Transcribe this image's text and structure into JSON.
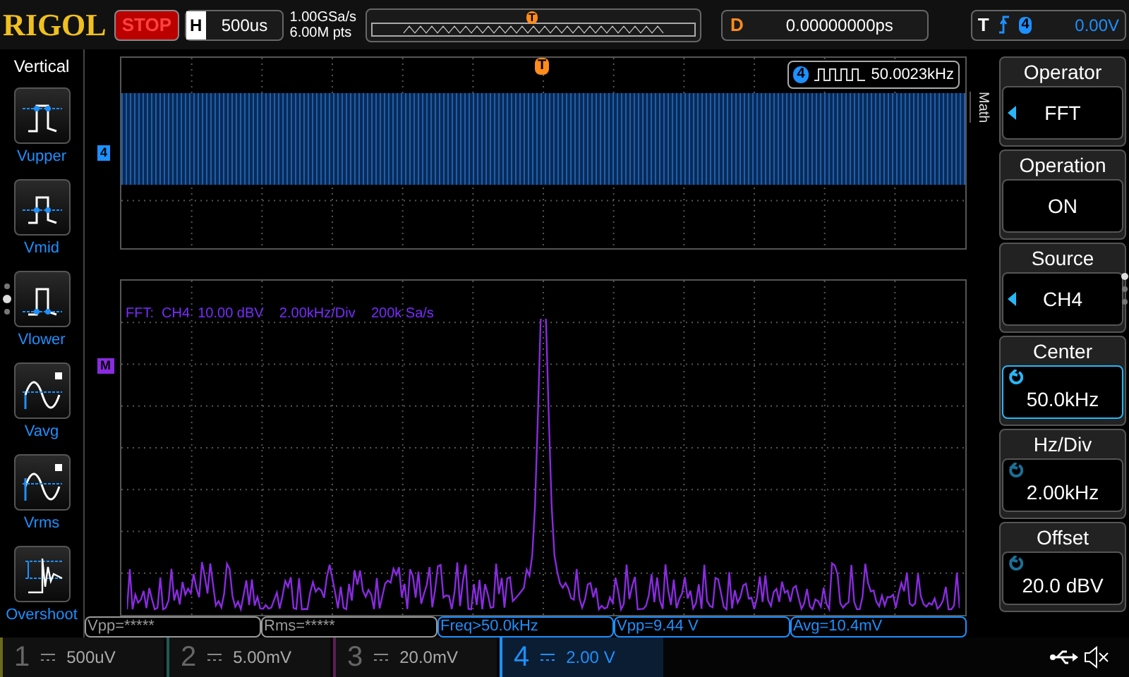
{
  "header": {
    "brand": "RIGOL",
    "run_state": "STOP",
    "timebase": {
      "label": "H",
      "value": "500us"
    },
    "sample_rate": "1.00GSa/s",
    "memory_depth": "6.00M pts",
    "memory_trigger_marker": "T",
    "delay": {
      "label": "D",
      "value": "0.00000000ps"
    },
    "trigger": {
      "label": "T",
      "channel": "4",
      "level": "0.00V"
    }
  },
  "left_menu": {
    "title": "Vertical",
    "items": [
      {
        "label": "Vupper",
        "kind": "upper"
      },
      {
        "label": "Vmid",
        "kind": "mid"
      },
      {
        "label": "Vlower",
        "kind": "lower"
      },
      {
        "label": "Vavg",
        "kind": "avg"
      },
      {
        "label": "Vrms",
        "kind": "rms"
      },
      {
        "label": "Overshoot",
        "kind": "overshoot"
      }
    ]
  },
  "upper_window": {
    "channel_marker": "4",
    "trigger_marker": "T",
    "frequency": {
      "channel": "4",
      "value": "50.0023kHz"
    },
    "side_tab": "Math"
  },
  "fft_window": {
    "marker": "M",
    "info": "FFT:  CH4  10.00 dBV    2.00kHz/Div    200k Sa/s"
  },
  "measurements": [
    {
      "text": "Vpp=*****",
      "color": "#9a9a9a"
    },
    {
      "text": "Rms=*****",
      "color": "#9a9a9a"
    },
    {
      "text": "Freq>50.0kHz",
      "color": "#1e90ff"
    },
    {
      "text": "Vpp=9.44 V",
      "color": "#1e90ff"
    },
    {
      "text": "Avg=10.4mV",
      "color": "#1e90ff"
    }
  ],
  "channels": [
    {
      "number": "1",
      "scale": "500uV",
      "color": "#6b6a1e",
      "enabled": false
    },
    {
      "number": "2",
      "scale": "5.00mV",
      "color": "#1e5a55",
      "enabled": false
    },
    {
      "number": "3",
      "scale": "20.0mV",
      "color": "#5a1e55",
      "enabled": false
    },
    {
      "number": "4",
      "scale": "2.00 V",
      "color": "#1e90ff",
      "enabled": true
    }
  ],
  "right_menu": [
    {
      "title": "Operator",
      "value": "FFT",
      "kind": "select",
      "selected": false
    },
    {
      "title": "Operation",
      "value": "ON",
      "kind": "plain",
      "selected": false
    },
    {
      "title": "Source",
      "value": "CH4",
      "kind": "select",
      "selected": false
    },
    {
      "title": "Center",
      "value": "50.0kHz",
      "kind": "knob",
      "selected": true
    },
    {
      "title": "Hz/Div",
      "value": "2.00kHz",
      "kind": "knob",
      "selected": false
    },
    {
      "title": "Offset",
      "value": "20.0 dBV",
      "kind": "knob",
      "selected": false
    }
  ]
}
